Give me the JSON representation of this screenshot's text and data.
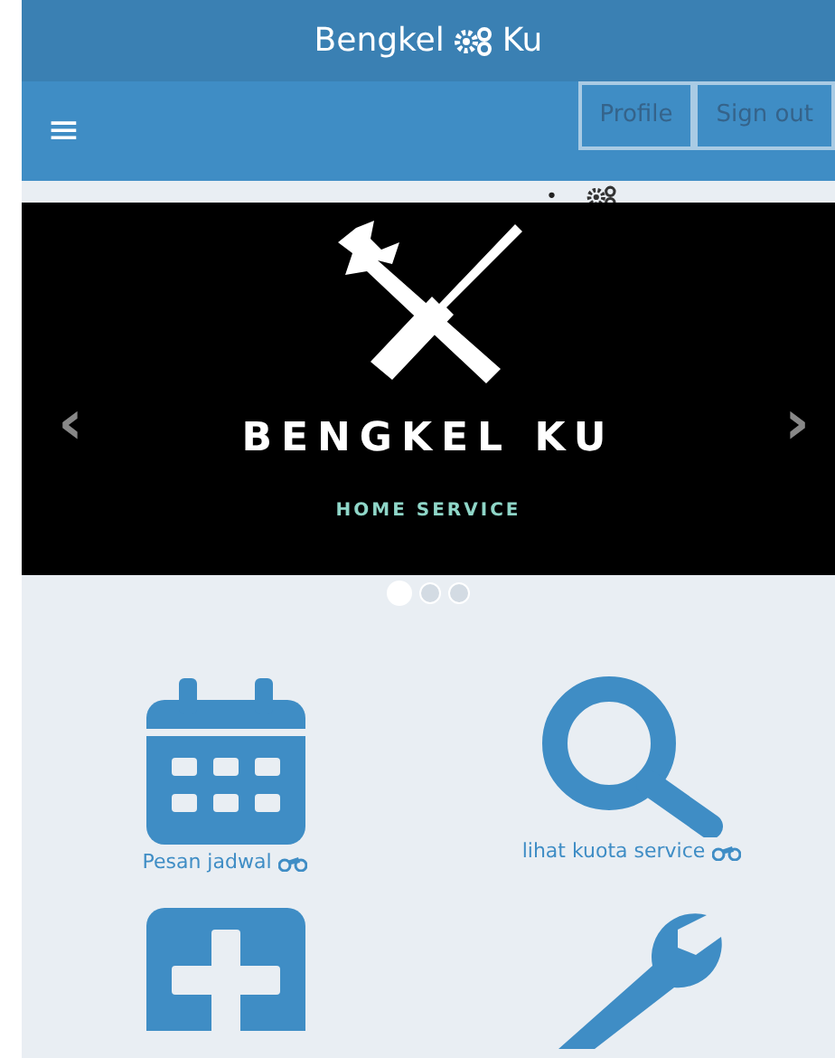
{
  "header": {
    "title_left": "Bengkel",
    "title_right": "Ku"
  },
  "navbar": {
    "menu_icon": "≡",
    "buttons": [
      "Profile",
      "Sign out"
    ],
    "bullet": "•"
  },
  "carousel": {
    "title": "BENGKEL KU",
    "subtitle": "HOME SERVICE",
    "prev": "‹",
    "next": "›",
    "indicators": [
      {
        "selected": true
      },
      {
        "selected": false
      },
      {
        "selected": false
      }
    ]
  },
  "menu": [
    {
      "kind": "calendar",
      "label": "Pesan jadwal"
    },
    {
      "kind": "search",
      "label": "lihat kuota service"
    },
    {
      "kind": "plus"
    },
    {
      "kind": "wrench"
    }
  ]
}
